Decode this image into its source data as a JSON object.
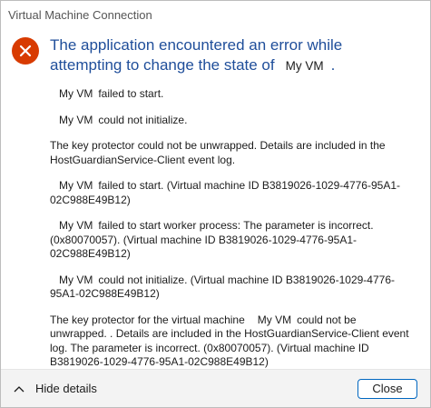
{
  "window": {
    "title": "Virtual Machine Connection"
  },
  "header": {
    "icon": "error-icon",
    "text_before": "The application encountered an error while attempting to change the state of",
    "vm_name": "My VM",
    "text_after": "."
  },
  "messages": [
    {
      "vm": "My VM",
      "text": "failed to start."
    },
    {
      "vm": "My VM",
      "text": "could not initialize."
    },
    {
      "vm": "",
      "text": "The key protector could not be unwrapped. Details are included in the HostGuardianService-Client event log."
    },
    {
      "vm": "My VM",
      "text": "failed to start. (Virtual machine ID B3819026-1029-4776-95A1-02C988E49B12)"
    },
    {
      "vm": "My VM",
      "text": "failed to start worker process: The parameter is incorrect. (0x80070057). (Virtual machine ID B3819026-1029-4776-95A1-02C988E49B12)"
    },
    {
      "vm": "My VM",
      "text": "could not initialize. (Virtual machine ID B3819026-1029-4776-95A1-02C988E49B12)"
    },
    {
      "prefix": "The key protector for the virtual machine",
      "vm": "My VM",
      "text": "could not be unwrapped. . Details are included in the HostGuardianService-Client event log. The parameter is incorrect. (0x80070057). (Virtual machine ID B3819026-1029-4776-95A1-02C988E49B12)"
    }
  ],
  "footer": {
    "hide_details_label": "Hide details",
    "close_label": "Close"
  },
  "colors": {
    "accent": "#0067c0",
    "header_text": "#1f4e9a",
    "error_icon": "#d83b01"
  }
}
